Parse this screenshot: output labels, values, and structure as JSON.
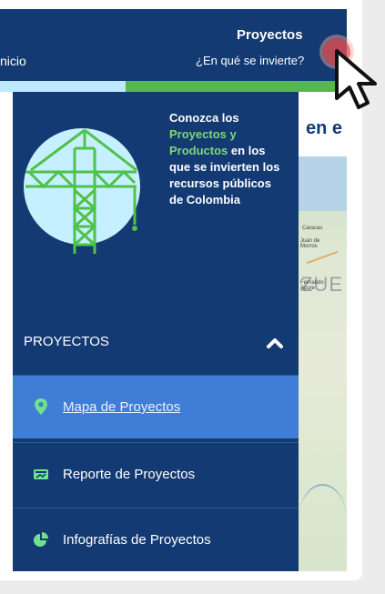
{
  "nav": {
    "inicio": "nicio",
    "title": "Proyectos",
    "subtitle": "¿En qué se invierte?"
  },
  "content": {
    "heading": "en e"
  },
  "map": {
    "country_text": "ZUE",
    "cities": [
      "Caracas",
      "Juan de Morros",
      "Fernando Apure"
    ]
  },
  "promo": {
    "line1": "Conozca los",
    "highlight": "Proyectos y Productos",
    "line2": "en los que se invierten los recursos públicos de Colombia"
  },
  "menu": {
    "section_label": "PROYECTOS",
    "section_icon": "chevron-up-icon",
    "items": [
      {
        "label": "Mapa de Proyectos",
        "icon": "map-pin-icon",
        "active": true
      },
      {
        "label": "Reporte de Proyectos",
        "icon": "report-icon",
        "active": false
      },
      {
        "label": "Infografías de Proyectos",
        "icon": "pie-chart-icon",
        "active": false
      }
    ]
  },
  "colors": {
    "nav_bg": "#133a73",
    "active_item": "#3f7dd6",
    "accent_green": "#54b94a",
    "accent_cyan": "#bfe9ff",
    "highlight_text": "#7fd877"
  }
}
